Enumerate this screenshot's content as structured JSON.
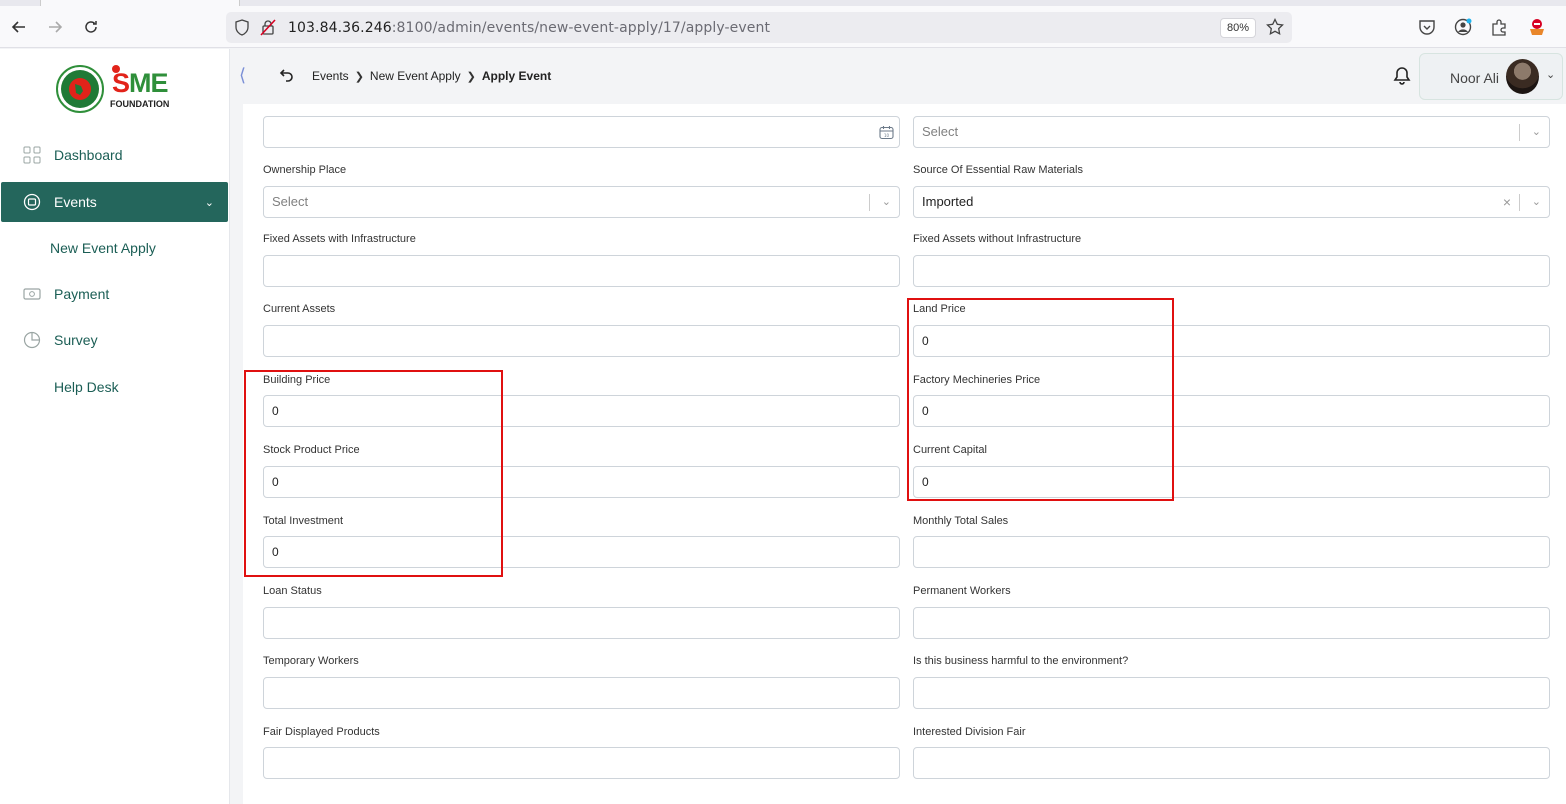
{
  "browser": {
    "url_host": "103.84.36.246",
    "url_path": ":8100/admin/events/new-event-apply/17/apply-event",
    "zoom": "80%"
  },
  "sidebar": {
    "logo_text": "SME",
    "logo_sub": "FOUNDATION",
    "items": [
      {
        "label": "Dashboard"
      },
      {
        "label": "Events"
      },
      {
        "label": "New Event Apply"
      },
      {
        "label": "Payment"
      },
      {
        "label": "Survey"
      },
      {
        "label": "Help Desk"
      }
    ]
  },
  "header": {
    "breadcrumb": [
      "Events",
      "New Event Apply",
      "Apply Event"
    ],
    "user_name": "Noor Ali"
  },
  "form": {
    "top_left_value": "",
    "top_right_placeholder": "Select",
    "ownership_place": {
      "label": "Ownership Place",
      "placeholder": "Select"
    },
    "source_raw": {
      "label": "Source Of Essential Raw Materials",
      "value": "Imported"
    },
    "fixed_with": {
      "label": "Fixed Assets with Infrastructure",
      "value": ""
    },
    "fixed_without": {
      "label": "Fixed Assets without Infrastructure",
      "value": ""
    },
    "current_assets": {
      "label": "Current Assets",
      "value": ""
    },
    "land_price": {
      "label": "Land Price",
      "value": "0"
    },
    "building_price": {
      "label": "Building Price",
      "value": "0"
    },
    "factory_price": {
      "label": "Factory Mechineries Price",
      "value": "0"
    },
    "stock_price": {
      "label": "Stock Product Price",
      "value": "0"
    },
    "current_capital": {
      "label": "Current Capital",
      "value": "0"
    },
    "total_investment": {
      "label": "Total Investment",
      "value": "0"
    },
    "monthly_sales": {
      "label": "Monthly Total Sales",
      "value": ""
    },
    "loan_status": {
      "label": "Loan Status",
      "value": ""
    },
    "permanent_workers": {
      "label": "Permanent Workers",
      "value": ""
    },
    "temporary_workers": {
      "label": "Temporary Workers",
      "value": ""
    },
    "harmful": {
      "label": "Is this business harmful to the environment?",
      "value": ""
    },
    "fair_products": {
      "label": "Fair Displayed Products",
      "value": ""
    },
    "interested_division": {
      "label": "Interested Division Fair",
      "value": ""
    }
  },
  "colors": {
    "brand_green": "#24665c",
    "highlight_red": "#e01010"
  }
}
